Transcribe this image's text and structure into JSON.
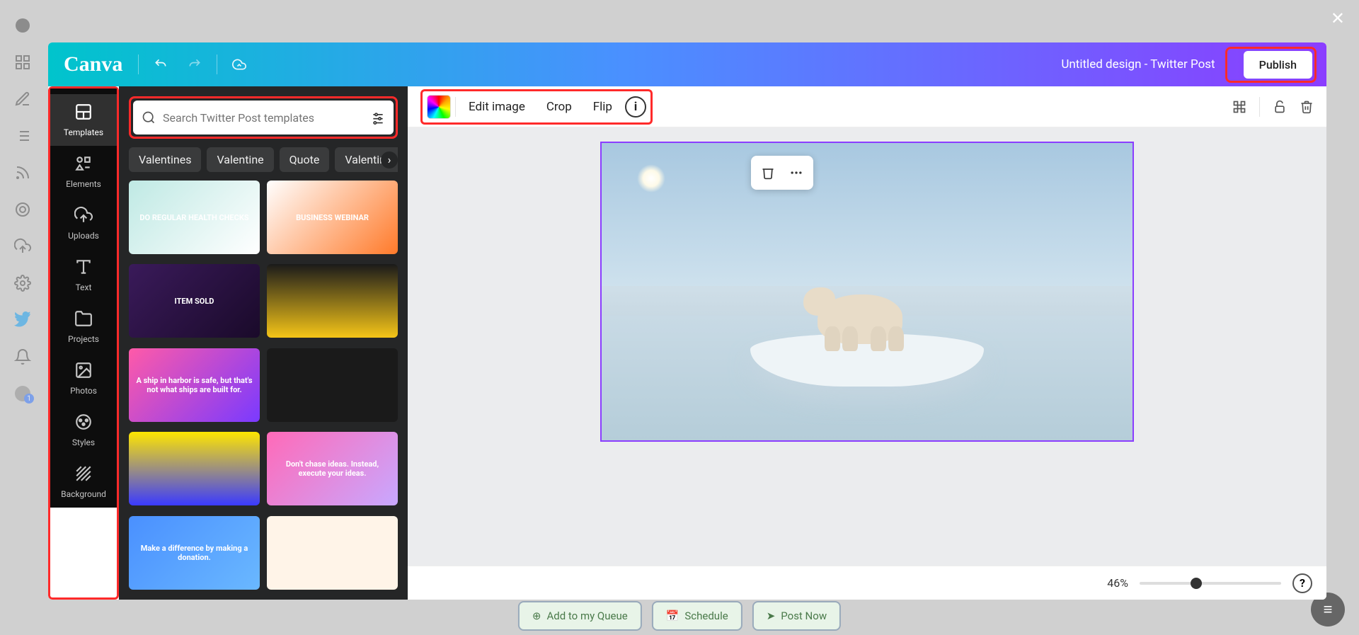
{
  "header": {
    "logo_text": "Canva",
    "title": "Untitled design - Twitter Post",
    "publish_label": "Publish"
  },
  "context_toolbar": {
    "edit_image": "Edit image",
    "crop": "Crop",
    "flip": "Flip"
  },
  "side_tabs": [
    {
      "id": "templates",
      "label": "Templates",
      "icon": "templates-icon"
    },
    {
      "id": "elements",
      "label": "Elements",
      "icon": "elements-icon"
    },
    {
      "id": "uploads",
      "label": "Uploads",
      "icon": "uploads-icon"
    },
    {
      "id": "text",
      "label": "Text",
      "icon": "text-icon"
    },
    {
      "id": "projects",
      "label": "Projects",
      "icon": "projects-icon"
    },
    {
      "id": "photos",
      "label": "Photos",
      "icon": "photos-icon"
    },
    {
      "id": "styles",
      "label": "Styles",
      "icon": "styles-icon"
    },
    {
      "id": "background",
      "label": "Background",
      "icon": "background-icon"
    }
  ],
  "search": {
    "placeholder": "Search Twitter Post templates"
  },
  "chips": [
    "Valentines",
    "Valentine",
    "Quote",
    "Valentine"
  ],
  "templates": [
    {
      "bg": "linear-gradient(135deg,#bfe9e4,#fff)",
      "text": "DO REGULAR HEALTH CHECKS"
    },
    {
      "bg": "linear-gradient(135deg,#fff,#ff7a2a)",
      "text": "BUSINESS WEBINAR"
    },
    {
      "bg": "linear-gradient(135deg,#3a1a5a,#1a0a2a)",
      "text": "ITEM SOLD"
    },
    {
      "bg": "linear-gradient(#1a1a1a,#f5c518)",
      "text": ""
    },
    {
      "bg": "linear-gradient(135deg,#ff5aa8,#7a3aff)",
      "text": "A ship in harbor is safe, but that's not what ships are built for."
    },
    {
      "bg": "#1a1a1a",
      "text": ""
    },
    {
      "bg": "linear-gradient(#ffe600,#3a3aff)",
      "text": ""
    },
    {
      "bg": "linear-gradient(135deg,#ff6ab8,#c8a8ff)",
      "text": "Don't chase ideas. Instead, execute your ideas."
    },
    {
      "bg": "linear-gradient(135deg,#4a90ff,#6ab8ff)",
      "text": "Make a difference by making a donation."
    },
    {
      "bg": "#fff4e8",
      "text": ""
    }
  ],
  "zoom": {
    "value": "46%"
  },
  "bottom_actions": {
    "queue": "Add to my Queue",
    "schedule": "Schedule",
    "post": "Post Now"
  }
}
